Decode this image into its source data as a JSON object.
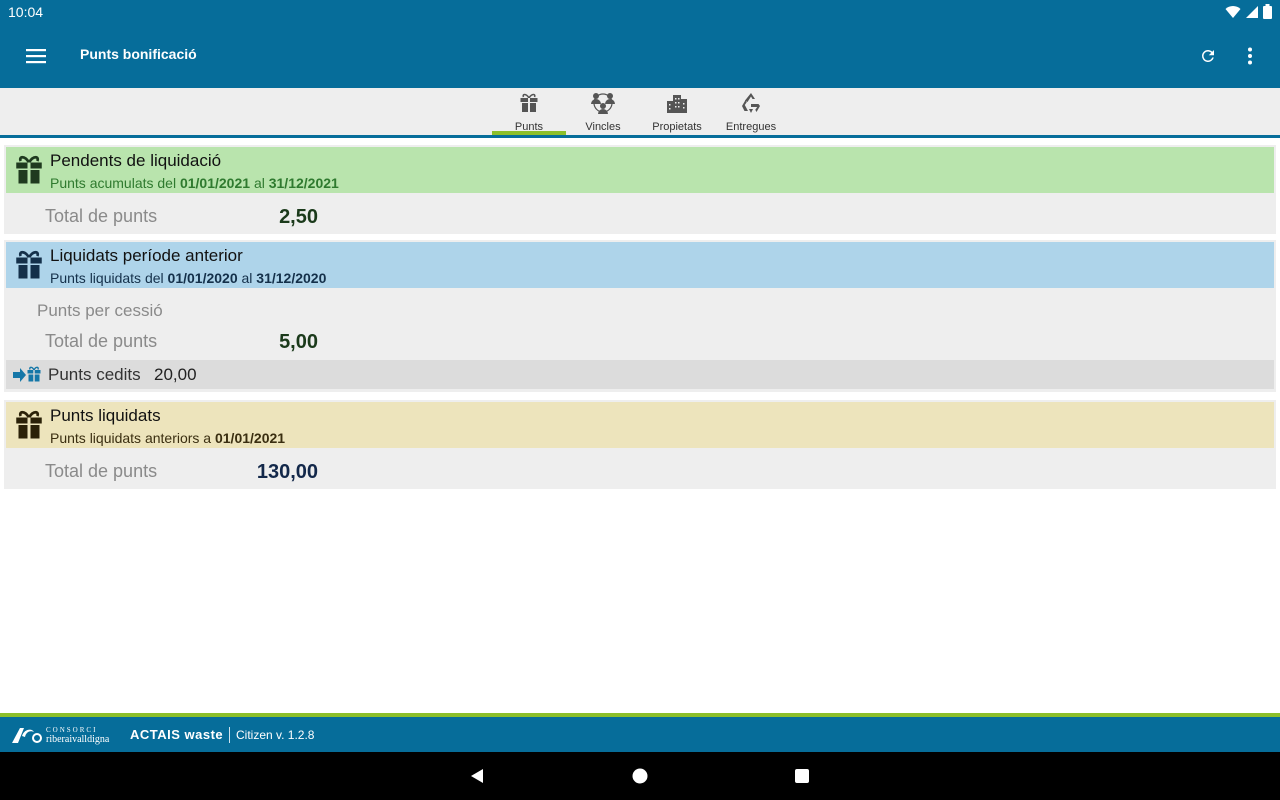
{
  "status_bar": {
    "time": "10:04"
  },
  "app_bar": {
    "title": "Punts bonificació"
  },
  "tabs": [
    {
      "label": "Punts",
      "icon": "gift-icon",
      "active": true
    },
    {
      "label": "Vincles",
      "icon": "people-icon",
      "active": false
    },
    {
      "label": "Propietats",
      "icon": "buildings-icon",
      "active": false
    },
    {
      "label": "Entregues",
      "icon": "recycle-icon",
      "active": false
    }
  ],
  "cards": {
    "pending": {
      "title": "Pendents de liquidació",
      "subtitle_prefix": "Punts acumulats del",
      "date_from": "01/01/2021",
      "joiner": "al",
      "date_to": "31/12/2021",
      "total_label": "Total de punts",
      "total_value": "2,50",
      "color": "#b9e4ad"
    },
    "previous": {
      "title": "Liquidats període anterior",
      "subtitle_prefix": "Punts liquidats del",
      "date_from": "01/01/2020",
      "joiner": "al",
      "date_to": "31/12/2020",
      "cession_label": "Punts per cessió",
      "total_label": "Total de punts",
      "total_value": "5,00",
      "ceded_label": "Punts cedits",
      "ceded_value": "20,00",
      "color": "#aed4ea"
    },
    "settled": {
      "title": "Punts liquidats",
      "subtitle_prefix": "Punts liquidats anteriors a",
      "date": "01/01/2021",
      "total_label": "Total de punts",
      "total_value": "130,00",
      "color": "#ede4bc"
    }
  },
  "footer": {
    "brand_top": "CONSORCI",
    "brand_name": "riberaivalldigna",
    "product": "ACTAIS waste",
    "version": "Citizen  v. 1.2.8"
  },
  "colors": {
    "primary": "#066d9a",
    "accent": "#8cbf2a"
  }
}
